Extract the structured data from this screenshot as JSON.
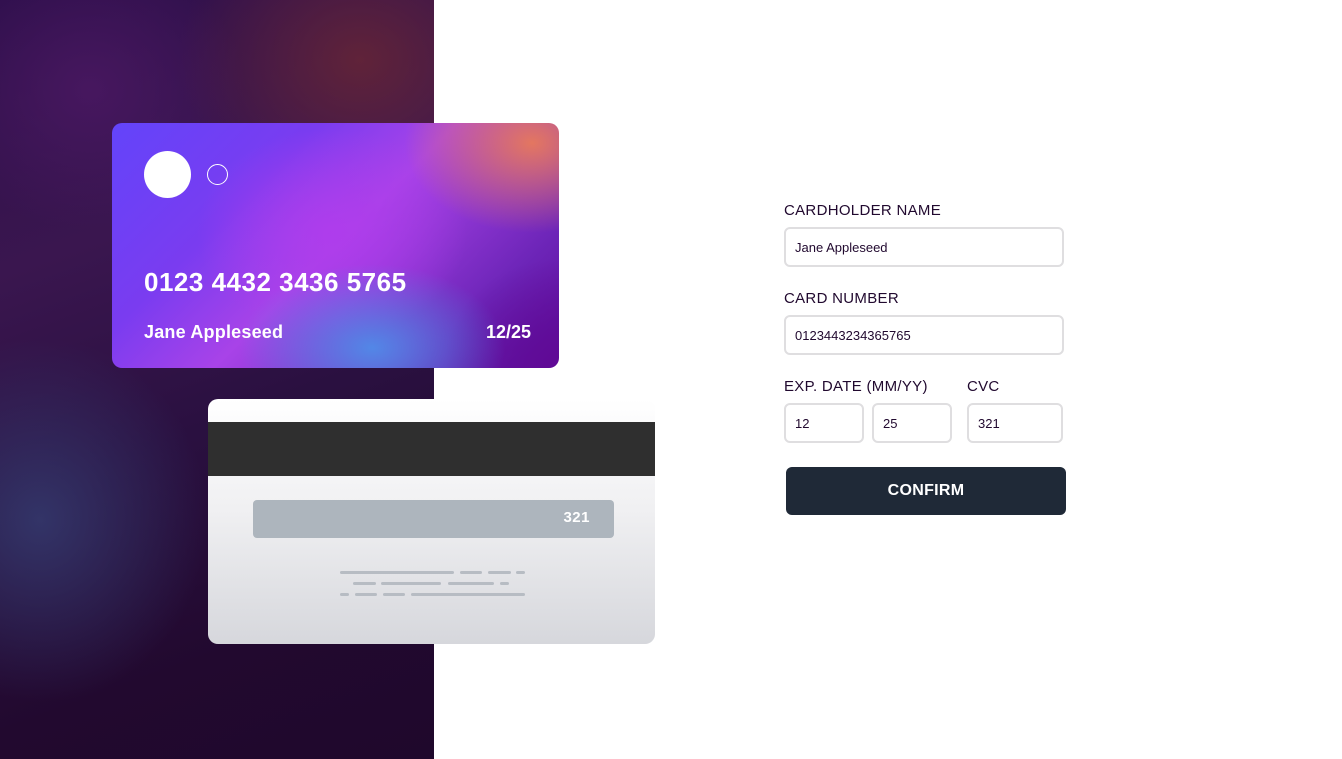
{
  "card_front": {
    "number": "0123 4432 3436 5765",
    "name": "Jane Appleseed",
    "expiry": "12/25"
  },
  "card_back": {
    "cvc": "321"
  },
  "form": {
    "name_label": "CARDHOLDER NAME",
    "name_value": "Jane Appleseed",
    "number_label": "CARD NUMBER",
    "number_value": "0123443234365765",
    "exp_label": "EXP. DATE (MM/YY)",
    "exp_month_value": "12",
    "exp_year_value": "25",
    "cvc_label": "CVC",
    "cvc_value": "321",
    "confirm_label": "CONFIRM"
  },
  "colors": {
    "button_bg": "#1f2937",
    "input_border": "#dfdee0",
    "cvc_strip": "#adb5bd",
    "mag_stripe": "#2f2f2f"
  }
}
